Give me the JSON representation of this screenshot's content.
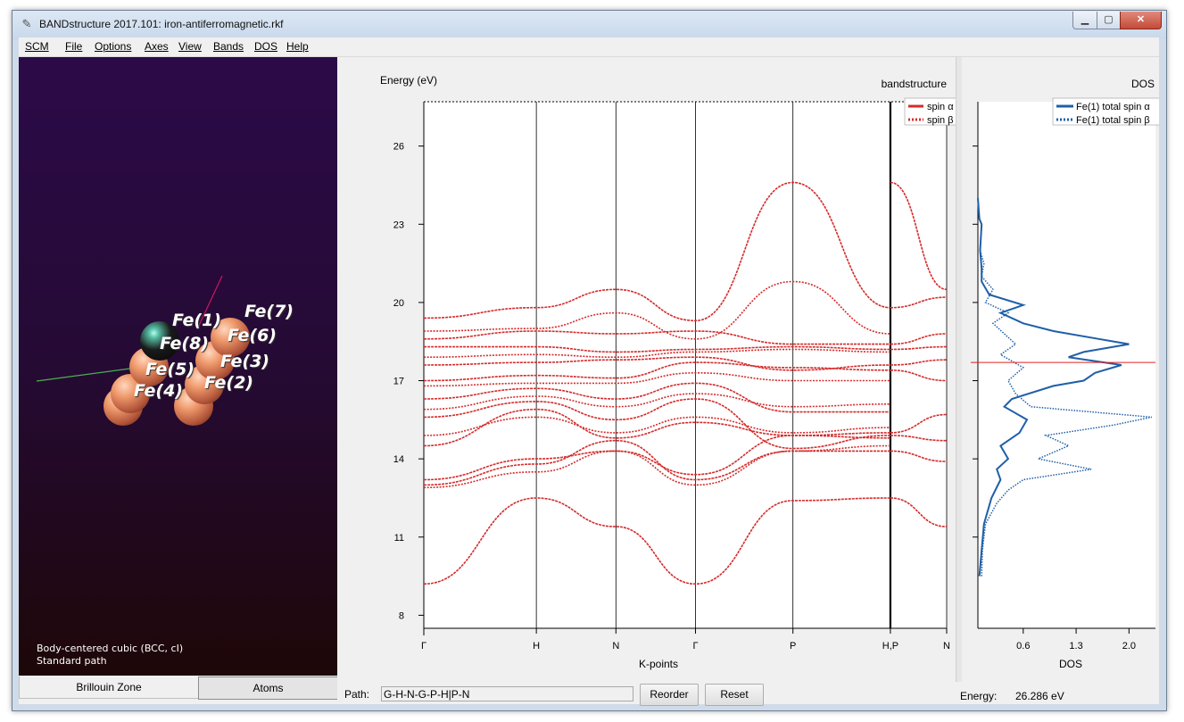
{
  "window": {
    "title": "BANDstructure 2017.101: iron-antiferromagnetic.rkf",
    "app_icon": "wrench-icon",
    "minimize": "minimize-icon",
    "maximize": "maximize-icon",
    "close": "close-icon"
  },
  "menu": [
    "SCM",
    "File",
    "Options",
    "Axes",
    "View",
    "Bands",
    "DOS",
    "Help"
  ],
  "viewer": {
    "atoms": [
      {
        "label": "Fe(1)"
      },
      {
        "label": "Fe(2)"
      },
      {
        "label": "Fe(3)"
      },
      {
        "label": "Fe(4)"
      },
      {
        "label": "Fe(5)"
      },
      {
        "label": "Fe(6)"
      },
      {
        "label": "Fe(7)"
      },
      {
        "label": "Fe(8)"
      }
    ],
    "lattice": "Body-centered cubic (BCC, cI)",
    "path_type": "Standard path",
    "tabs": [
      "Brillouin Zone",
      "Atoms"
    ],
    "colors": {
      "background_top": "#2c0a48",
      "background_bottom": "#1e0708",
      "atom": "#ef9a6c",
      "axis_x": "#4caf50",
      "axis_y": "#c2185b"
    }
  },
  "bandplot": {
    "ylabel": "Energy (eV)",
    "title": "bandstructure",
    "xlabel": "K-points",
    "legend": [
      "spin α",
      "spin β"
    ]
  },
  "dosplot": {
    "title": "DOS",
    "xlabel": "DOS",
    "legend": [
      "Fe(1)  total spin α",
      "Fe(1)  total spin β"
    ]
  },
  "bottom": {
    "path_label": "Path:",
    "path_value": "G-H-N-G-P-H|P-N",
    "reorder": "Reorder",
    "reset": "Reset",
    "energy_label": "Energy:",
    "energy_value": "26.286 eV"
  },
  "chart_data": [
    {
      "type": "line",
      "title": "bandstructure",
      "xlabel": "K-points",
      "ylabel": "Energy (eV)",
      "ylim": [
        7.5,
        27.7
      ],
      "yticks": [
        8,
        11,
        14,
        17,
        20,
        23,
        26
      ],
      "kpoints": [
        {
          "label": "Γ",
          "x": 0.0
        },
        {
          "label": "H",
          "x": 1.0
        },
        {
          "label": "N",
          "x": 1.707
        },
        {
          "label": "Γ",
          "x": 2.414
        },
        {
          "label": "P",
          "x": 3.28
        },
        {
          "label": "H,P",
          "x": 4.146
        },
        {
          "label": "N",
          "x": 4.646
        }
      ],
      "fermi_level": 17.7,
      "color": "#d42b2b",
      "series": [
        {
          "name": "spin α",
          "style": "solid",
          "bands": [
            {
              "x": [
                0.0,
                1.0,
                1.707,
                2.414,
                3.28,
                4.146
              ],
              "y": [
                9.2,
                12.5,
                11.4,
                9.2,
                12.4,
                12.5
              ]
            },
            {
              "x": [
                0.0,
                1.0,
                1.707,
                2.414,
                3.28,
                4.146
              ],
              "y": [
                13.0,
                13.8,
                14.7,
                13.2,
                14.3,
                14.3
              ]
            },
            {
              "x": [
                0.0,
                1.0,
                1.707,
                2.414,
                3.28,
                4.146
              ],
              "y": [
                13.2,
                14.0,
                14.3,
                13.4,
                14.9,
                14.8
              ]
            },
            {
              "x": [
                0.0,
                1.0,
                1.707,
                2.414,
                3.28,
                4.146
              ],
              "y": [
                14.5,
                15.9,
                14.8,
                15.4,
                14.9,
                15.0
              ]
            },
            {
              "x": [
                0.0,
                1.0,
                1.707,
                2.414,
                3.28,
                4.146
              ],
              "y": [
                15.6,
                16.2,
                15.5,
                16.3,
                14.4,
                14.9
              ]
            },
            {
              "x": [
                0.0,
                1.0,
                1.707,
                2.414,
                3.28,
                4.146
              ],
              "y": [
                16.3,
                16.7,
                16.3,
                16.9,
                15.8,
                15.8
              ]
            },
            {
              "x": [
                0.0,
                1.0,
                1.707,
                2.414,
                3.28,
                4.146
              ],
              "y": [
                17.0,
                17.2,
                17.1,
                17.7,
                17.5,
                17.4
              ]
            },
            {
              "x": [
                0.0,
                1.0,
                1.707,
                2.414,
                3.28,
                4.146
              ],
              "y": [
                17.6,
                17.7,
                17.8,
                17.9,
                17.4,
                17.6
              ]
            },
            {
              "x": [
                0.0,
                1.0,
                1.707,
                2.414,
                3.28,
                4.146
              ],
              "y": [
                18.3,
                18.3,
                18.1,
                18.2,
                18.3,
                18.2
              ]
            },
            {
              "x": [
                0.0,
                1.0,
                1.707,
                2.414,
                3.28,
                4.146
              ],
              "y": [
                18.6,
                18.9,
                18.8,
                18.9,
                18.4,
                18.4
              ]
            },
            {
              "x": [
                0.0,
                1.0,
                1.707,
                2.414,
                3.28,
                4.146
              ],
              "y": [
                19.4,
                19.8,
                20.5,
                19.3,
                24.6,
                19.8
              ]
            }
          ]
        },
        {
          "name": "spin β",
          "style": "dotted",
          "bands": [
            {
              "x": [
                0.0,
                1.0,
                1.707,
                2.414,
                3.28,
                4.146
              ],
              "y": [
                12.9,
                13.5,
                14.3,
                13.0,
                14.3,
                14.5
              ]
            },
            {
              "x": [
                0.0,
                1.0,
                1.707,
                2.414,
                3.28,
                4.146
              ],
              "y": [
                14.9,
                15.6,
                15.0,
                15.6,
                15.0,
                15.2
              ]
            },
            {
              "x": [
                0.0,
                1.0,
                1.707,
                2.414,
                3.28,
                4.146
              ],
              "y": [
                15.9,
                16.4,
                16.0,
                16.5,
                16.0,
                16.1
              ]
            },
            {
              "x": [
                0.0,
                1.0,
                1.707,
                2.414,
                3.28,
                4.146
              ],
              "y": [
                16.8,
                16.9,
                16.9,
                17.3,
                17.0,
                17.0
              ]
            },
            {
              "x": [
                0.0,
                1.0,
                1.707,
                2.414,
                3.28,
                4.146
              ],
              "y": [
                17.9,
                18.0,
                17.9,
                18.1,
                18.2,
                18.1
              ]
            },
            {
              "x": [
                0.0,
                1.0,
                1.707,
                2.414,
                3.28,
                4.146
              ],
              "y": [
                18.9,
                19.0,
                19.6,
                18.6,
                20.8,
                18.8
              ]
            }
          ]
        }
      ],
      "segment_right": [
        {
          "x": [
            4.146,
            4.646
          ],
          "y": [
            12.5,
            11.4
          ]
        },
        {
          "x": [
            4.146,
            4.646
          ],
          "y": [
            24.6,
            20.5
          ]
        },
        {
          "x": [
            4.146,
            4.646
          ],
          "y": [
            14.3,
            13.9
          ]
        },
        {
          "x": [
            4.146,
            4.646
          ],
          "y": [
            14.9,
            14.7
          ]
        },
        {
          "x": [
            4.146,
            4.646
          ],
          "y": [
            15.0,
            15.7
          ]
        },
        {
          "x": [
            4.146,
            4.646
          ],
          "y": [
            17.4,
            17.0
          ]
        },
        {
          "x": [
            4.146,
            4.646
          ],
          "y": [
            17.6,
            17.8
          ]
        },
        {
          "x": [
            4.146,
            4.646
          ],
          "y": [
            18.2,
            18.3
          ]
        },
        {
          "x": [
            4.146,
            4.646
          ],
          "y": [
            18.4,
            18.8
          ]
        },
        {
          "x": [
            4.146,
            4.646
          ],
          "y": [
            19.8,
            20.2
          ]
        }
      ]
    },
    {
      "type": "line",
      "title": "DOS",
      "xlabel": "DOS",
      "xticks": [
        0.6,
        1.3,
        2.0
      ],
      "xlim": [
        0.0,
        2.35
      ],
      "ylim": [
        7.5,
        27.7
      ],
      "fermi_level": 17.7,
      "color": "#1f5fa8",
      "series": [
        {
          "name": "Fe(1)  total spin α",
          "style": "solid",
          "energy": [
            9.5,
            10.5,
            11.5,
            12.5,
            13.2,
            13.6,
            14.0,
            14.5,
            15.0,
            15.5,
            16.0,
            16.3,
            16.8,
            17.0,
            17.3,
            17.6,
            17.9,
            18.1,
            18.4,
            18.6,
            18.9,
            19.2,
            19.6,
            19.9,
            20.3,
            20.8,
            21.3,
            22.0,
            23.0,
            23.2,
            24.0
          ],
          "dos": [
            0.02,
            0.05,
            0.08,
            0.18,
            0.3,
            0.25,
            0.4,
            0.3,
            0.55,
            0.65,
            0.35,
            0.45,
            1.0,
            1.4,
            1.55,
            1.9,
            1.2,
            1.4,
            2.0,
            1.6,
            1.0,
            0.6,
            0.3,
            0.6,
            0.15,
            0.05,
            0.05,
            0.03,
            0.05,
            0.02,
            0.0
          ]
        },
        {
          "name": "Fe(1)  total spin β",
          "style": "dotted",
          "energy": [
            9.5,
            10.5,
            11.5,
            12.3,
            12.8,
            13.2,
            13.6,
            14.0,
            14.5,
            14.9,
            15.3,
            15.6,
            16.0,
            16.5,
            17.0,
            17.5,
            18.0,
            18.4,
            18.8,
            19.2,
            19.6,
            20.0,
            20.5,
            21.0,
            21.5,
            22.0
          ],
          "dos": [
            0.05,
            0.06,
            0.1,
            0.25,
            0.4,
            0.6,
            1.5,
            0.8,
            1.2,
            0.9,
            1.8,
            2.3,
            0.7,
            0.5,
            0.4,
            0.6,
            0.3,
            0.5,
            0.35,
            0.2,
            0.4,
            0.1,
            0.2,
            0.05,
            0.08,
            0.03
          ]
        }
      ]
    }
  ]
}
